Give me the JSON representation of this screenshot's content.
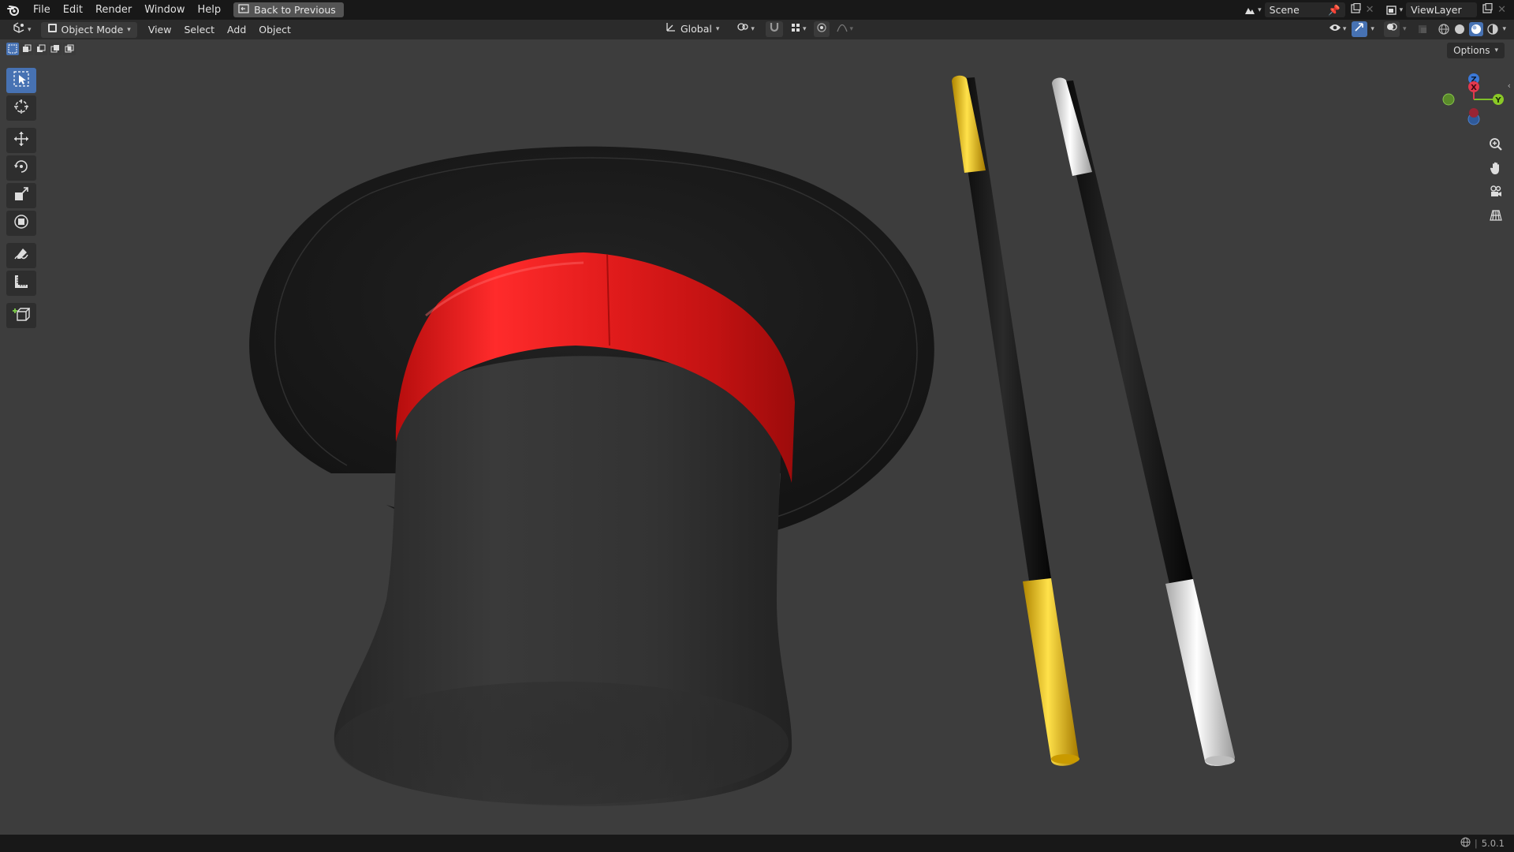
{
  "topbar": {
    "menus": [
      "File",
      "Edit",
      "Render",
      "Window",
      "Help"
    ],
    "back_button": "Back to Previous",
    "scene": "Scene",
    "view_layer": "ViewLayer"
  },
  "header": {
    "mode": "Object Mode",
    "menus": [
      "View",
      "Select",
      "Add",
      "Object"
    ],
    "transform_orientation": "Global"
  },
  "viewport": {
    "options_label": "Options",
    "gizmo": {
      "x": "X",
      "y": "Y",
      "z": "Z"
    }
  },
  "status": {
    "version": "5.0.1"
  },
  "colors": {
    "accent": "#4772b3",
    "band": "#e01b1b",
    "gold": "#f3c515",
    "silver": "#f2f2f2"
  }
}
